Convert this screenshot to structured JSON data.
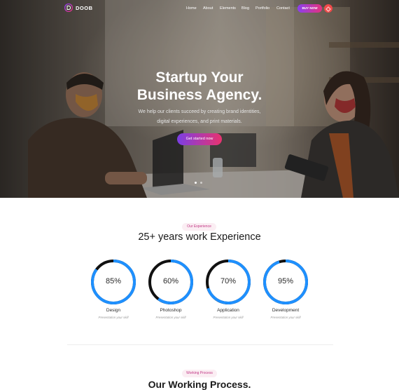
{
  "brand": {
    "name": "DOOB",
    "accent": "#e5327c",
    "accent2": "#8a3ff0"
  },
  "nav": [
    {
      "label": "Home"
    },
    {
      "label": "About"
    },
    {
      "label": "Elements"
    },
    {
      "label": "Blog"
    },
    {
      "label": "Portfolio"
    },
    {
      "label": "Contact"
    }
  ],
  "buy_button": "BUY NOW",
  "theme_toggle_icon": "sun-moon-icon",
  "hero": {
    "title_line1": "Startup Your",
    "title_line2": "Business Agency.",
    "subtitle_line1": "We help our clients succeed by creating brand identities,",
    "subtitle_line2": "digital experiences, and print materials.",
    "cta": "Get started now",
    "slide_count": 2,
    "active_slide": 1
  },
  "experience": {
    "tag": "Our Experience",
    "title": "25+ years work Experience",
    "skills": [
      {
        "name": "Design",
        "value": "85%",
        "percent": 85,
        "desc": "Presentation your skill"
      },
      {
        "name": "Photoshop",
        "value": "60%",
        "percent": 60,
        "desc": "Presentation your skill"
      },
      {
        "name": "Application",
        "value": "70%",
        "percent": 70,
        "desc": "Presentation your skill"
      },
      {
        "name": "Development",
        "value": "95%",
        "percent": 95,
        "desc": "Presentation your skill"
      }
    ],
    "ring_color": "#1e90ff",
    "track_color": "#111111"
  },
  "process": {
    "tag": "Working Process",
    "title": "Our Working Process."
  }
}
